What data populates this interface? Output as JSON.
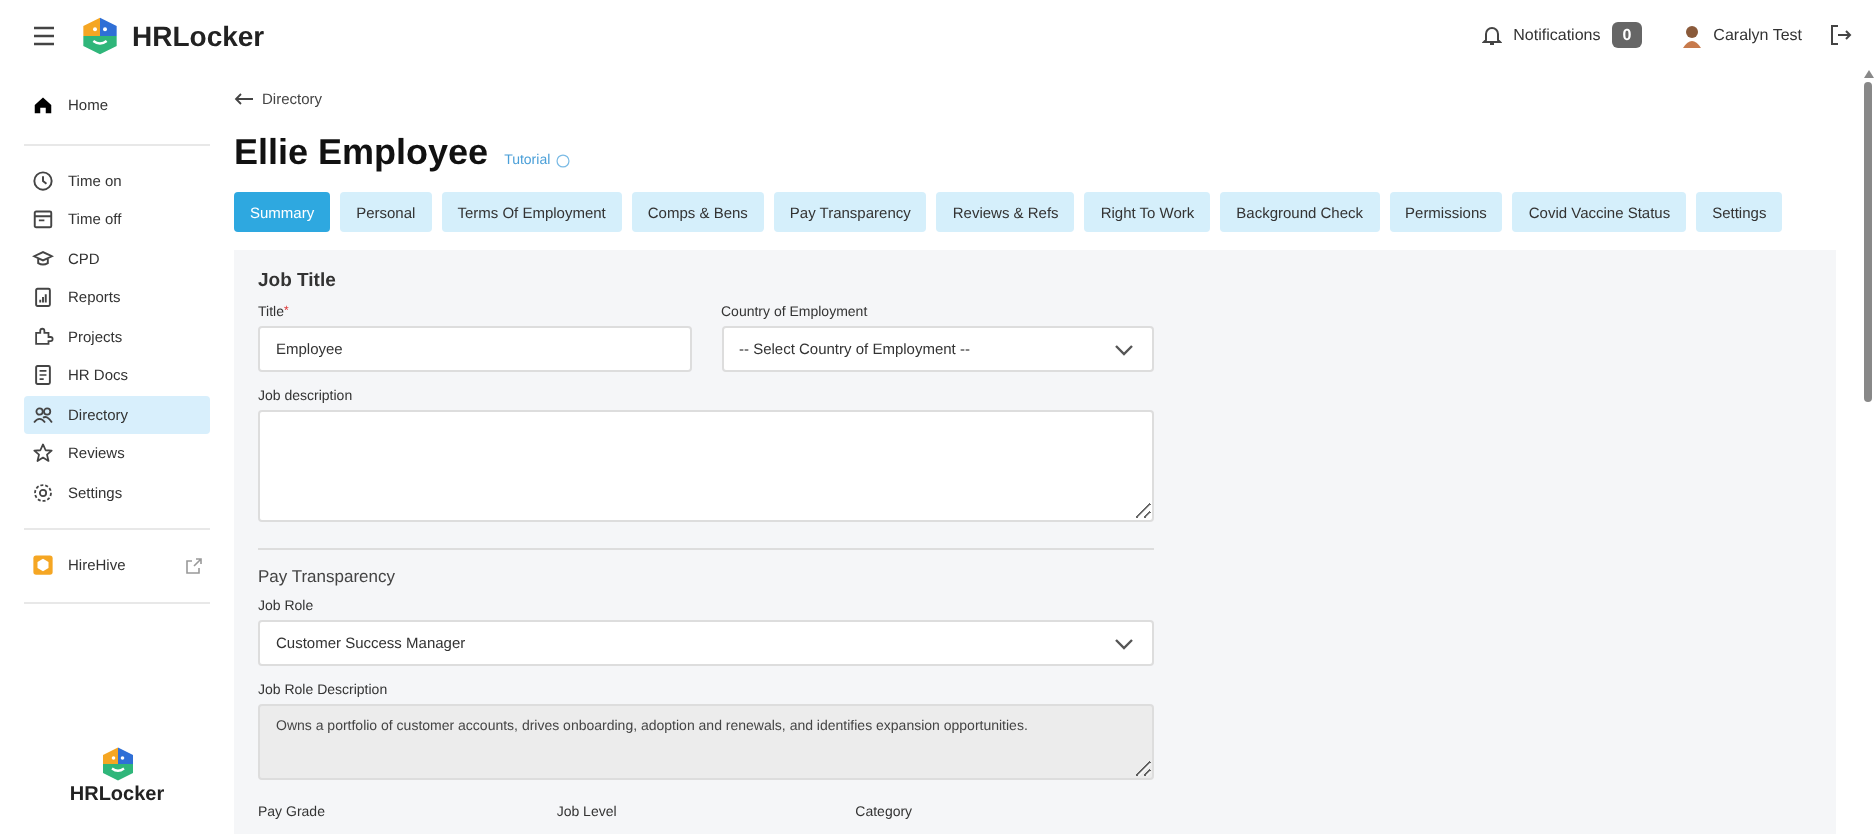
{
  "header": {
    "brand": "HRLocker",
    "notifications_label": "Notifications",
    "notifications_count": "0",
    "user_name": "Caralyn Test"
  },
  "sidebar": {
    "groups": [
      {
        "items": [
          {
            "label": "Home",
            "selected": false
          }
        ]
      },
      {
        "items": [
          {
            "label": "Time on",
            "selected": false
          },
          {
            "label": "Time off",
            "selected": false
          },
          {
            "label": "CPD",
            "selected": false
          },
          {
            "label": "Reports",
            "selected": false
          },
          {
            "label": "Projects",
            "selected": false
          },
          {
            "label": "HR Docs",
            "selected": false
          },
          {
            "label": "Directory",
            "selected": true
          },
          {
            "label": "Reviews",
            "selected": false
          },
          {
            "label": "Settings",
            "selected": false
          }
        ]
      },
      {
        "items": [
          {
            "label": "HireHive",
            "selected": false,
            "external": true
          }
        ]
      }
    ],
    "footer_brand": "HRLocker"
  },
  "breadcrumb": "Directory",
  "page_title": "Ellie Employee",
  "tutorial_link": "Tutorial",
  "tabs": [
    {
      "label": "Summary",
      "selected": true
    },
    {
      "label": "Personal",
      "selected": false
    },
    {
      "label": "Terms Of Employment",
      "selected": false
    },
    {
      "label": "Comps & Bens",
      "selected": false
    },
    {
      "label": "Pay Transparency",
      "selected": false
    },
    {
      "label": "Reviews & Refs",
      "selected": false
    },
    {
      "label": "Right To Work",
      "selected": false
    },
    {
      "label": "Background Check",
      "selected": false
    },
    {
      "label": "Permissions",
      "selected": false
    },
    {
      "label": "Covid Vaccine Status",
      "selected": false
    },
    {
      "label": "Settings",
      "selected": false
    }
  ],
  "job_title_section": {
    "heading": "Job Title",
    "title_field": {
      "label": "Title",
      "required_mark": "*",
      "value": "Employee"
    },
    "country_field": {
      "label": "Country of Employment",
      "placeholder": "-- Select Country of Employment --"
    },
    "job_description": {
      "label": "Job description"
    }
  },
  "pay_transparency_section": {
    "heading": "Pay Transparency",
    "job_role": {
      "label": "Job Role",
      "value": "Customer Success Manager"
    },
    "job_role_description": {
      "label": "Job Role Description",
      "value": "Owns a portfolio of customer accounts, drives onboarding, adoption and renewals, and identifies expansion opportunities."
    },
    "bottom_labels": [
      "Pay Grade",
      "Job Level",
      "Category"
    ]
  }
}
